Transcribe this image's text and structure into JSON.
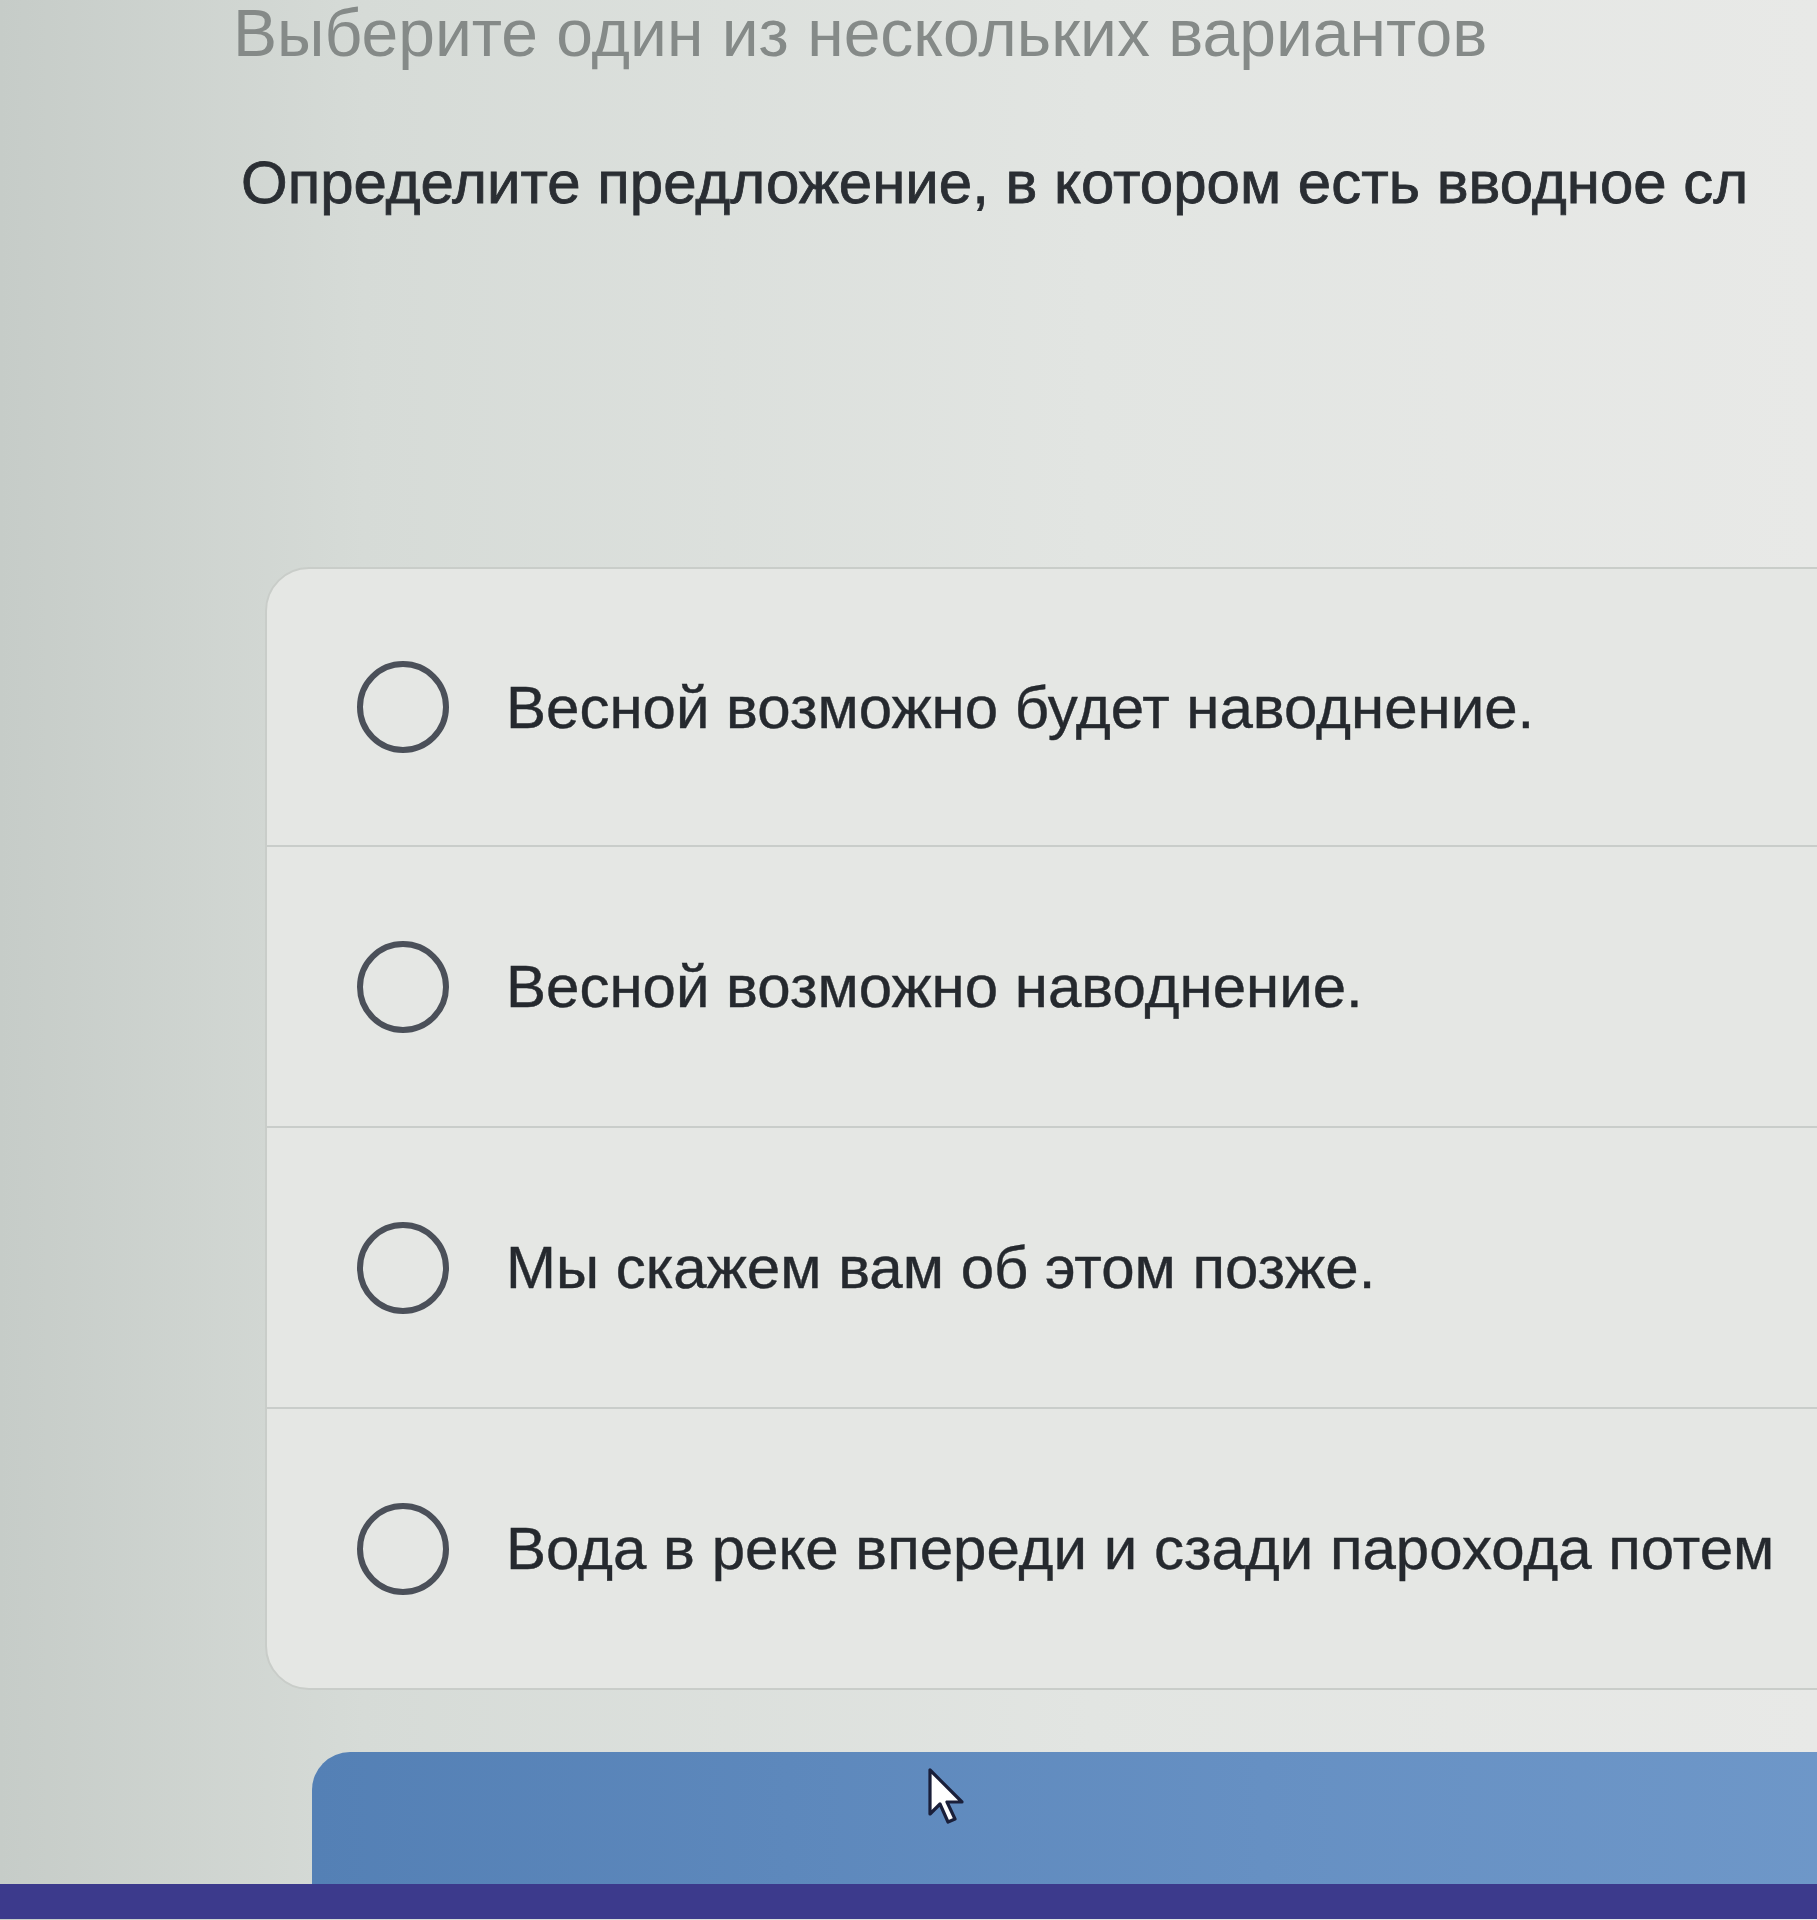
{
  "header": {
    "title": "Выберите один из нескольких вариантов"
  },
  "question": {
    "text": "Определите предложение, в котором есть вводное сл"
  },
  "options": [
    {
      "label": "Весной возможно будет наводнение.",
      "selected": false
    },
    {
      "label": "Весной возможно наводнение.",
      "selected": false
    },
    {
      "label": "Мы скажем вам об этом позже.",
      "selected": false
    },
    {
      "label": "Вода в реке впереди и сзади парохода потем",
      "selected": false
    }
  ]
}
